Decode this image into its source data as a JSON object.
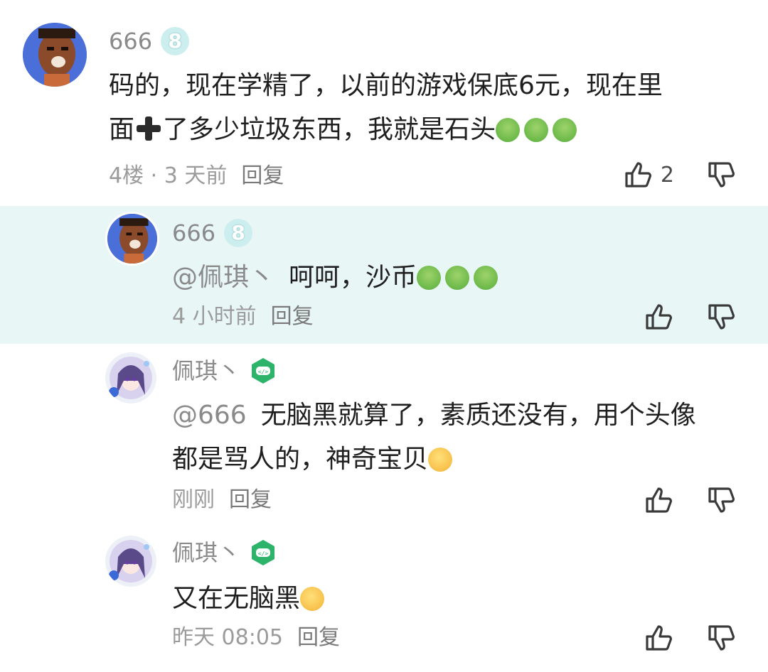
{
  "comments": [
    {
      "username": "666",
      "level": "8",
      "text_a": "码的，现在学精了，以前的游戏保底6元，现在里",
      "text_b1": "面",
      "text_b2": "了多少垃圾东西，我就是石头",
      "meta_floor": "4楼 · 3 天前",
      "reply": "回复",
      "likes": "2"
    },
    {
      "username": "666",
      "level": "8",
      "mention": "@佩琪丶",
      "text": "呵呵，沙币",
      "time": "4 小时前",
      "reply": "回复"
    },
    {
      "username": "佩琪丶",
      "mention": "@666",
      "text_a": "无脑黑就算了，素质还没有，用个头像",
      "text_b": "都是骂人的，神奇宝贝",
      "time": "刚刚",
      "reply": "回复"
    },
    {
      "username": "佩琪丶",
      "text": "又在无脑黑",
      "time": "昨天 08:05",
      "reply": "回复"
    }
  ],
  "icons": {
    "like": "thumbs-up-icon",
    "dislike": "thumbs-down-icon",
    "emoji_sick": "nauseated-face-emoji",
    "emoji_smirk": "smirk-face-emoji",
    "plus": "heavy-plus-icon",
    "dev_badge": "game-controller-badge-icon"
  },
  "colors": {
    "highlight_bg": "#e8f6f6",
    "badge_green": "#2db46a",
    "level_badge": "#cdeeee"
  }
}
